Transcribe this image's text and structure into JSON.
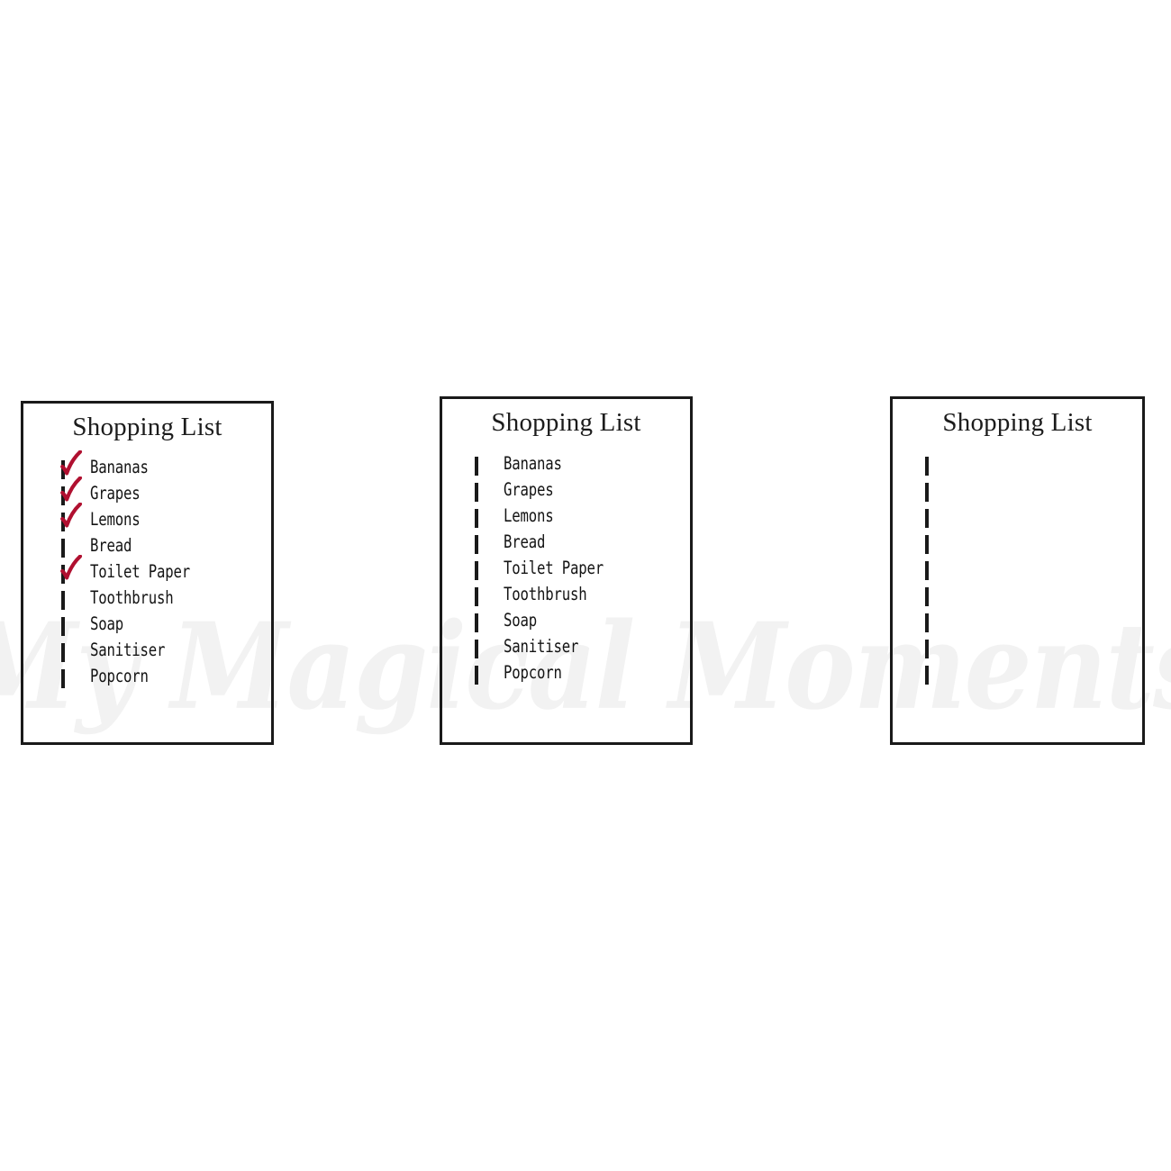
{
  "watermark": {
    "text": "My Magical Moments",
    "color": "#f2f2f2"
  },
  "colors": {
    "border": "#1a1a1a",
    "checkmark": "#b01030",
    "text": "#141414",
    "background": "#ffffff"
  },
  "cards": [
    {
      "id": "checked-list",
      "title": "Shopping List",
      "items": [
        {
          "label": "Bananas",
          "checked": true
        },
        {
          "label": "Grapes",
          "checked": true
        },
        {
          "label": "Lemons",
          "checked": true
        },
        {
          "label": "Bread",
          "checked": false
        },
        {
          "label": "Toilet Paper",
          "checked": true
        },
        {
          "label": "Toothbrush",
          "checked": false
        },
        {
          "label": "Soap",
          "checked": false
        },
        {
          "label": "Sanitiser",
          "checked": false
        },
        {
          "label": "Popcorn",
          "checked": false
        }
      ]
    },
    {
      "id": "unchecked-list",
      "title": "Shopping List",
      "items": [
        {
          "label": "Bananas",
          "checked": false
        },
        {
          "label": "Grapes",
          "checked": false
        },
        {
          "label": "Lemons",
          "checked": false
        },
        {
          "label": "Bread",
          "checked": false
        },
        {
          "label": "Toilet Paper",
          "checked": false
        },
        {
          "label": "Toothbrush",
          "checked": false
        },
        {
          "label": "Soap",
          "checked": false
        },
        {
          "label": "Sanitiser",
          "checked": false
        },
        {
          "label": "Popcorn",
          "checked": false
        }
      ]
    },
    {
      "id": "blank-list",
      "title": "Shopping List",
      "items": [
        {
          "label": "",
          "checked": false
        },
        {
          "label": "",
          "checked": false
        },
        {
          "label": "",
          "checked": false
        },
        {
          "label": "",
          "checked": false
        },
        {
          "label": "",
          "checked": false
        },
        {
          "label": "",
          "checked": false
        },
        {
          "label": "",
          "checked": false
        },
        {
          "label": "",
          "checked": false
        },
        {
          "label": "",
          "checked": false
        }
      ]
    }
  ]
}
